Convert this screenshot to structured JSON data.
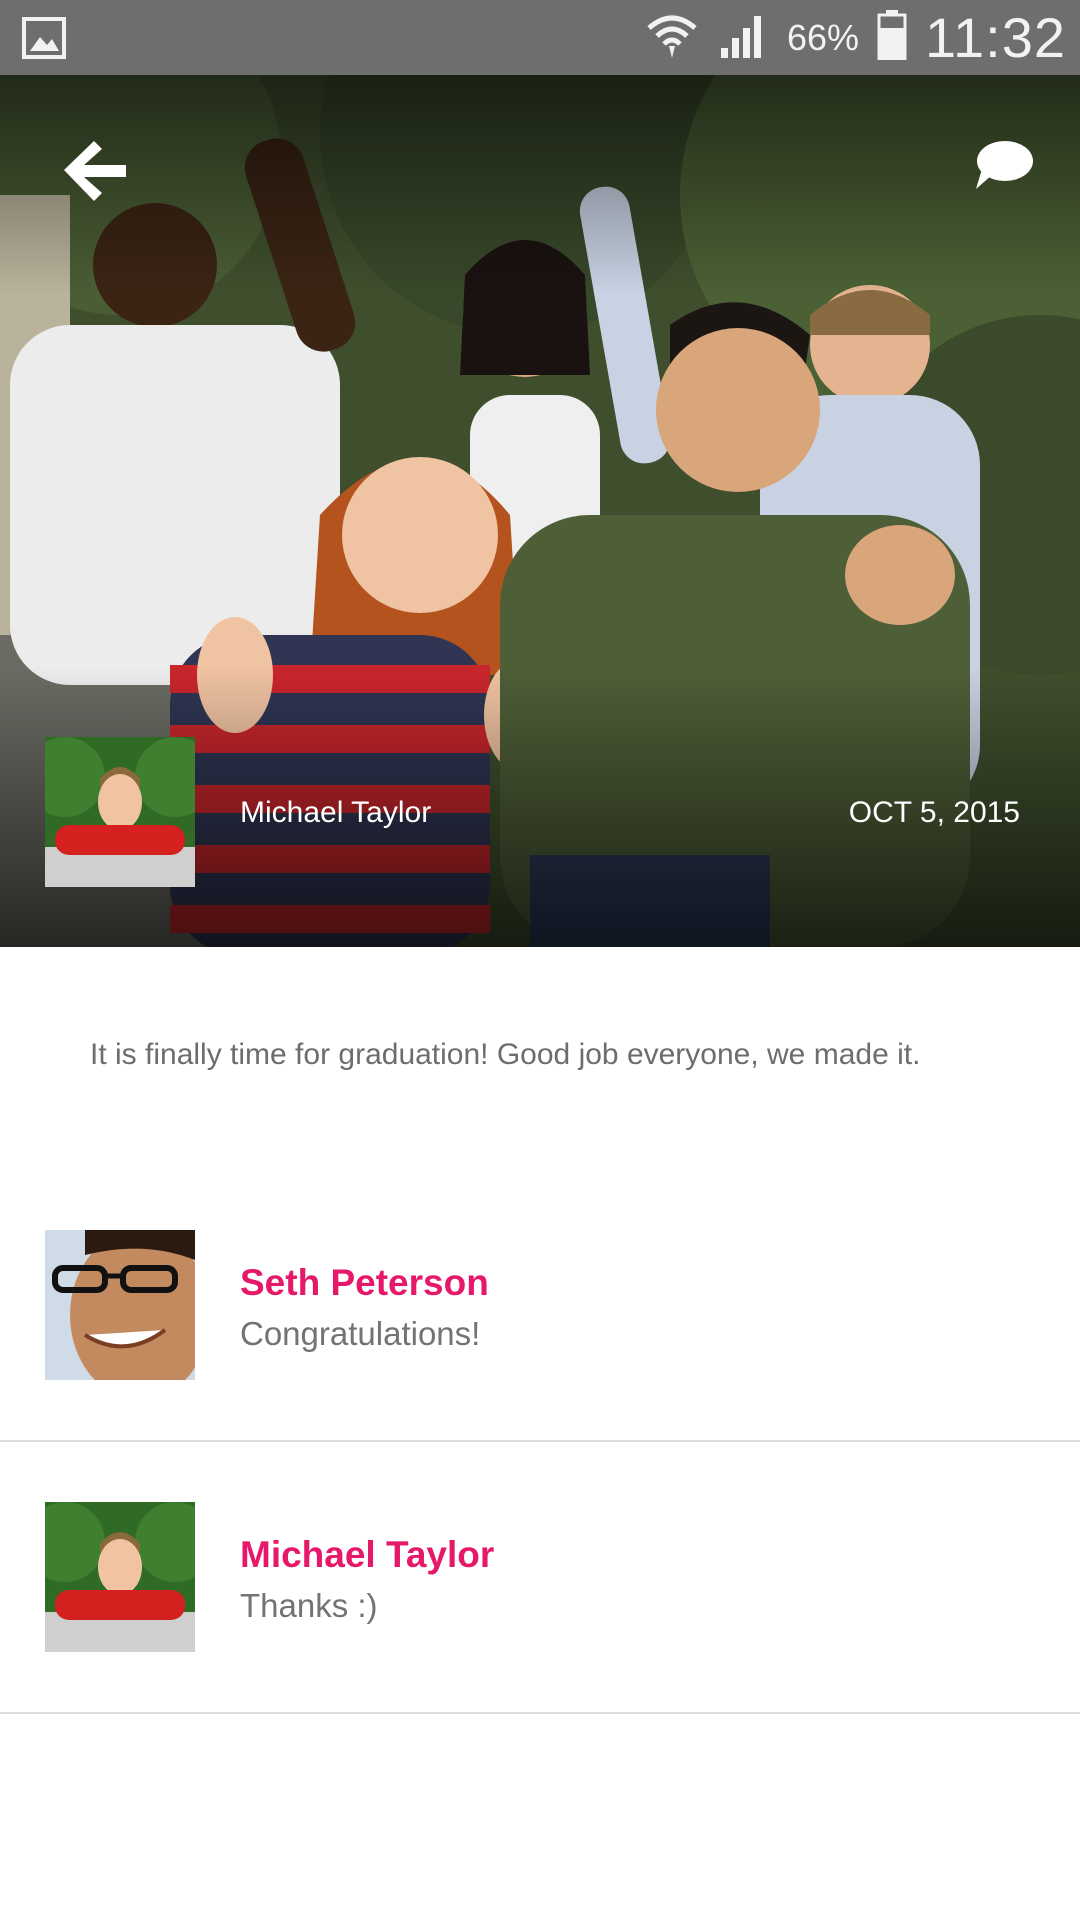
{
  "status_bar": {
    "battery": "66%",
    "time": "11:32"
  },
  "post": {
    "author": "Michael Taylor",
    "date": "OCT 5, 2015",
    "text": "It is finally time for graduation! Good job everyone, we made it."
  },
  "comments": [
    {
      "name": "Seth Peterson",
      "text": "Congratulations!"
    },
    {
      "name": "Michael Taylor",
      "text": "Thanks :)"
    }
  ],
  "colors": {
    "accent": "#e5186a",
    "status_bar": "#6e6e6e",
    "divider": "#dcdcdc"
  },
  "icons": {
    "back": "back-arrow-icon",
    "chat": "chat-bubble-icon",
    "gallery": "gallery-icon",
    "wifi": "wifi-icon",
    "signal": "signal-icon",
    "battery": "battery-icon"
  }
}
